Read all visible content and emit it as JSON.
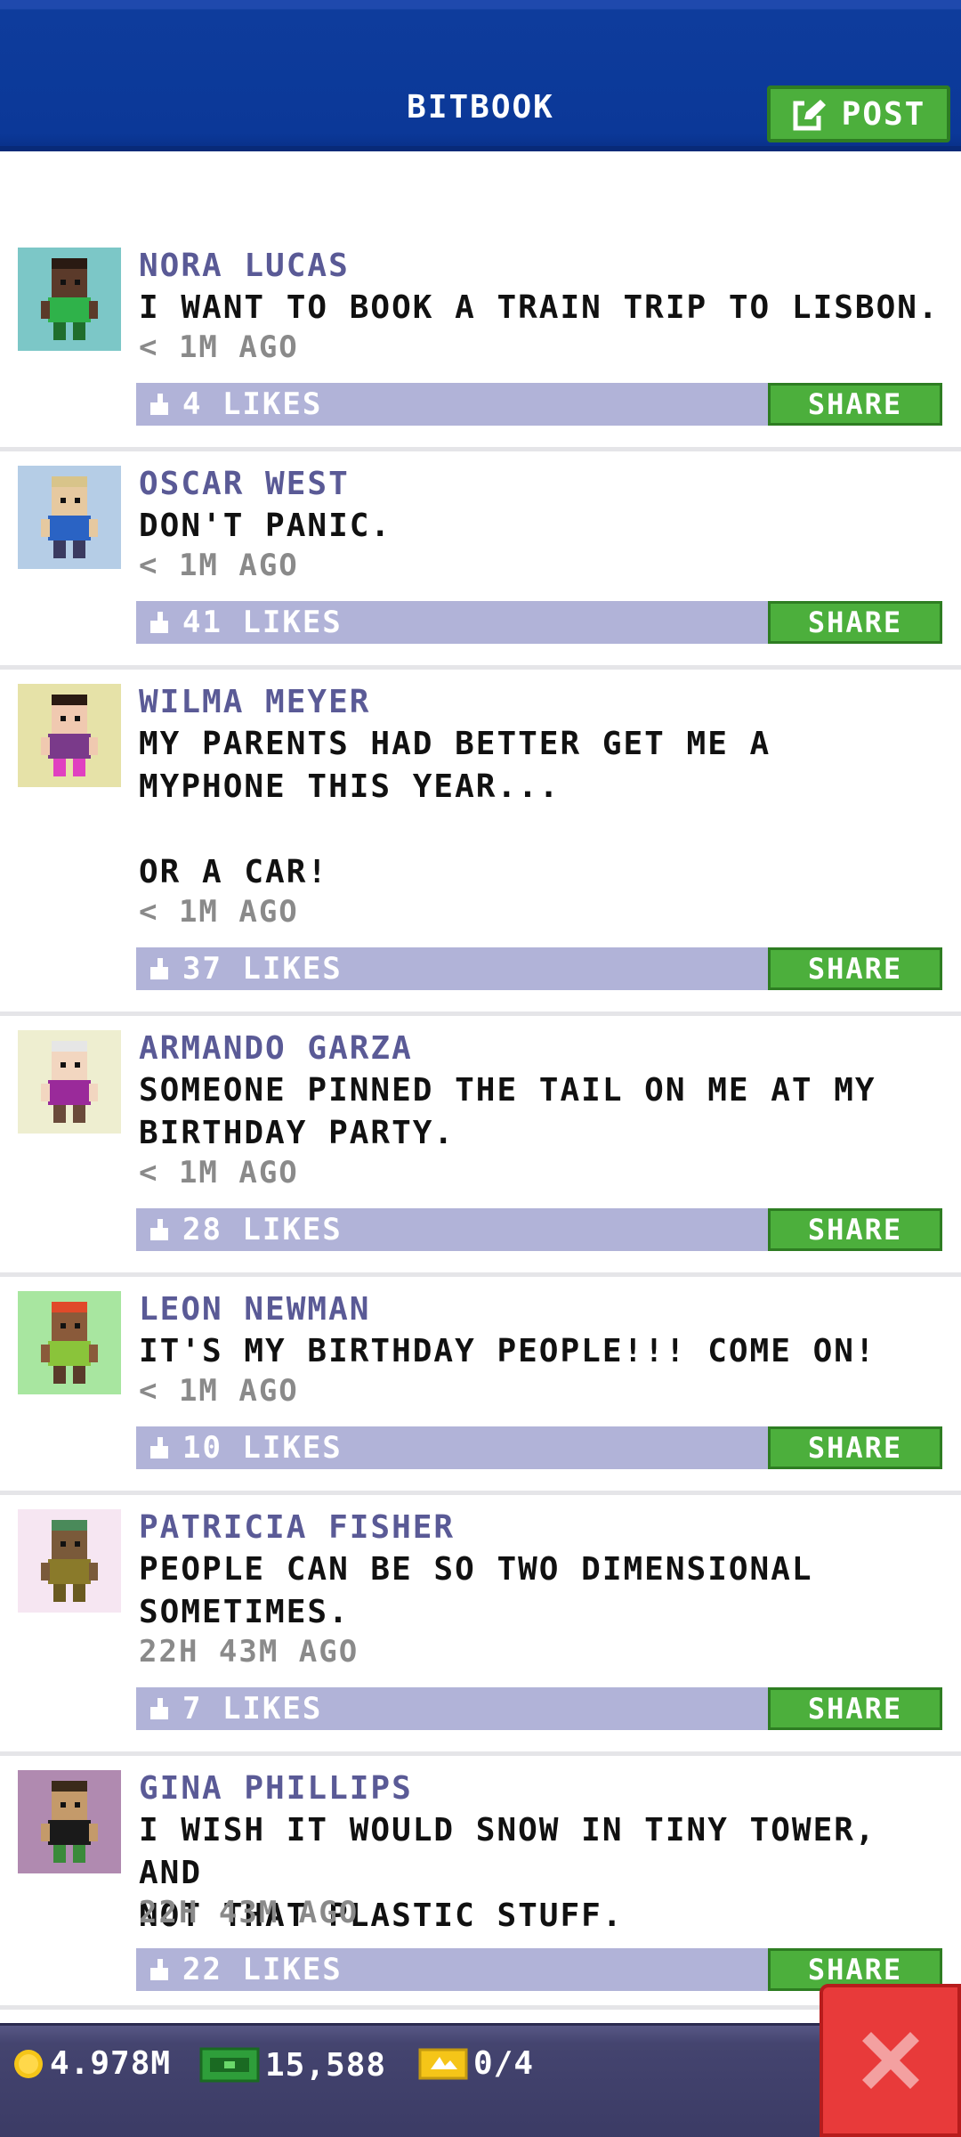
{
  "header": {
    "title": "BITBOOK",
    "post_label": "POST"
  },
  "posts": [
    {
      "name": "NORA LUCAS",
      "text": "I WANT TO BOOK A TRAIN TRIP TO LISBON.",
      "time": "< 1M AGO",
      "likes": "4 LIKES",
      "share": "SHARE",
      "avatar_bg": "#7cc7c7",
      "skin": "#5b3a2a",
      "hair": "#2a1a12",
      "shirt": "#2fb24a",
      "pants": "#1f6e2c"
    },
    {
      "name": "OSCAR WEST",
      "text": "DON'T PANIC.",
      "time": "< 1M AGO",
      "likes": "41 LIKES",
      "share": "SHARE",
      "avatar_bg": "#b5cde6",
      "skin": "#e6c9a0",
      "hair": "#d8c48a",
      "shirt": "#2a63c4",
      "pants": "#3a3a60"
    },
    {
      "name": "WILMA MEYER",
      "text": "MY PARENTS HAD BETTER GET ME A\nMYPHONE THIS YEAR...\n\nOR A CAR!",
      "time": "< 1M AGO",
      "likes": "37 LIKES",
      "share": "SHARE",
      "avatar_bg": "#e6e2a8",
      "skin": "#f0c9b0",
      "hair": "#2a1a12",
      "shirt": "#7a3a8a",
      "pants": "#e040c0"
    },
    {
      "name": "ARMANDO GARZA",
      "text": "SOMEONE PINNED THE TAIL ON ME AT MY\nBIRTHDAY PARTY.",
      "time": "< 1M AGO",
      "likes": "28 LIKES",
      "share": "SHARE",
      "avatar_bg": "#eeeed0",
      "skin": "#f2d6c0",
      "hair": "#e6e6e6",
      "shirt": "#9a2a9a",
      "pants": "#6a4a3a"
    },
    {
      "name": "LEON NEWMAN",
      "text": "IT'S MY BIRTHDAY PEOPLE!!! COME ON!",
      "time": "< 1M AGO",
      "likes": "10 LIKES",
      "share": "SHARE",
      "avatar_bg": "#a8e6a0",
      "skin": "#8a5a3a",
      "hair": "#e04a2a",
      "shirt": "#8ac43a",
      "pants": "#5a3a2a"
    },
    {
      "name": "PATRICIA FISHER",
      "text": "PEOPLE CAN BE SO TWO DIMENSIONAL\nSOMETIMES.",
      "time": "22H 43M AGO",
      "likes": "7 LIKES",
      "share": "SHARE",
      "avatar_bg": "#f6e6f2",
      "skin": "#7a5a3a",
      "hair": "#4a8a5a",
      "shirt": "#8a7a2a",
      "pants": "#6a5a20"
    },
    {
      "name": "GINA PHILLIPS",
      "text": "I WISH IT WOULD SNOW IN TINY TOWER, AND\nNOT THAT PLASTIC STUFF.",
      "time": "22H 43M AGO",
      "likes": "22 LIKES",
      "share": "SHARE",
      "avatar_bg": "#b08ab0",
      "skin": "#c49a6a",
      "hair": "#3a2a1a",
      "shirt": "#1a1a1a",
      "pants": "#3a8a3a"
    }
  ],
  "status_bar": {
    "coins": "4.978M",
    "bux": "15,588",
    "tickets": "0/4"
  },
  "colors": {
    "header_blue": "#0b3898",
    "accent_green": "#4caf3c",
    "likes_bar": "#b1b3d8",
    "close_red": "#e83a3a",
    "name_color": "#5a5a96"
  }
}
